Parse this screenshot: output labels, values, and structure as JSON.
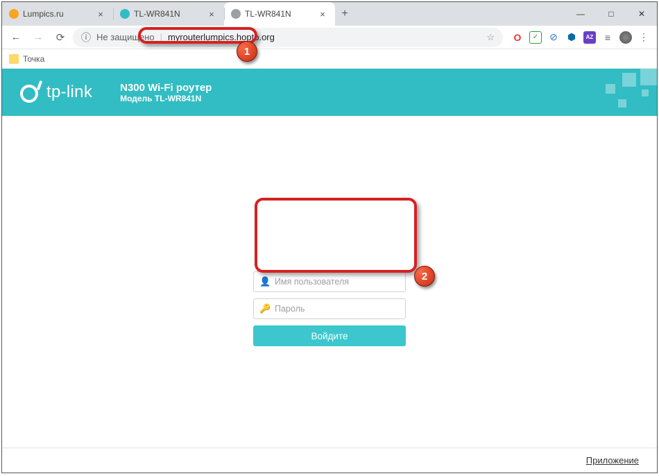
{
  "window": {
    "minimize": "—",
    "maximize": "□",
    "close": "✕"
  },
  "tabs": [
    {
      "label": "Lumpics.ru",
      "favcolor": "#f5a623",
      "active": false
    },
    {
      "label": "TL-WR841N",
      "favcolor": "#32bcc3",
      "active": false
    },
    {
      "label": "TL-WR841N",
      "favcolor": "#9aa0a4",
      "active": true
    }
  ],
  "newtab": "+",
  "toolbar": {
    "back": "←",
    "forward": "→",
    "reload": "⟳",
    "secure_icon": "ⓘ",
    "secure_text": "Не защищено",
    "url": "myrouterlumpics.hopto.org",
    "star": "☆",
    "menu": "⋮"
  },
  "ext": {
    "opera": "O",
    "check": "✓",
    "shield": "⊘",
    "cube": "⬢",
    "az": "AZ",
    "list": "≡"
  },
  "bookmarks": {
    "item1": "Точка"
  },
  "header": {
    "brand": "tp-link",
    "title": "N300 Wi-Fi роутер",
    "model": "Модель TL-WR841N"
  },
  "login": {
    "user_icon": "👤",
    "user_placeholder": "Имя пользователя",
    "pass_icon": "🔑",
    "pass_placeholder": "Пароль",
    "button": "Войдите"
  },
  "footer": {
    "app": "Приложение"
  },
  "callouts": {
    "one": "1",
    "two": "2"
  },
  "colors": {
    "accent": "#32bcc3",
    "highlight": "#d62122"
  }
}
